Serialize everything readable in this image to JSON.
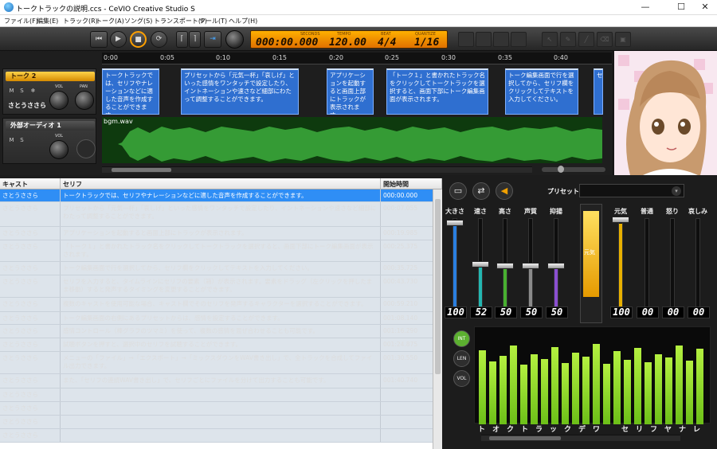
{
  "window": {
    "title": "トークトラックの説明.ccs - CeVIO Creative Studio S",
    "min": "—",
    "max": "☐",
    "close": "✕"
  },
  "menu": [
    "ファイル(F)",
    "編集(E)",
    "トラック(R)",
    "トーク(A)",
    "ソング(S)",
    "トランスポート(P)",
    "ツール(T)",
    "ヘルプ(H)"
  ],
  "transport": {
    "labels": [
      "SECONDS",
      "TEMPO",
      "BEAT",
      "QUANTIZE"
    ],
    "seconds": "000:00.000",
    "tempo": "120.00",
    "beat": "4/4",
    "quantize": "1/16"
  },
  "ruler": [
    "0:00",
    "0:05",
    "0:10",
    "0:15",
    "0:20",
    "0:25",
    "0:30",
    "0:35",
    "0:40"
  ],
  "tracks": [
    {
      "name": "トーク 2",
      "cast": "さとうささら",
      "vol": "VOL",
      "pan": "PAN",
      "m": "M",
      "s": "S"
    },
    {
      "name": "外部オーディオ 1",
      "m": "M",
      "s": "S",
      "vol": "VOL",
      "file": "bgm.wav"
    }
  ],
  "blocks": [
    "トークトラックでは、セリフやナレーションなどに適した音声を作成することができます。",
    "プリセットから「元気一杯」「哀しげ」といった感情をワンタッチで設定したり、イントネーションや速さなど細部にわたって調整することができます。",
    "アプリケーションを起動すると画面上部にトラックが表示されます。",
    "「トーク１」と書かれたトラック名をクリックしてトークトラックを選択すると、画面下部にトーク編集画面が表示されます。",
    "トーク編集画面で行を選択してから、セリフ欄をクリックしてテキストを入力してください。",
    "セ"
  ],
  "grid": {
    "headers": [
      "キャスト",
      "セリフ",
      "開始時間"
    ],
    "rows": [
      {
        "cast": "さとうささら",
        "text": "トークトラックでは、セリフやナレーションなどに適した音声を作成することができます。",
        "time": "000:00.000"
      },
      {
        "cast": "さとうささら",
        "text": "プリセットから「元気一杯」「哀しげ」といった感情をワンタッチで設定したり、イントネーションや速さなど細部にわたって調整することができます。",
        "time": "000:07.055"
      },
      {
        "cast": "さとうささら",
        "text": "アプリケーションを起動すると画面上部にトラックが表示されます。",
        "time": "000:19.985"
      },
      {
        "cast": "さとうささら",
        "text": "「トーク１」と書かれたトラック名をクリックしてトークトラックを選択すると、画面下部にトーク編集画面が表示されます。",
        "time": "000:25.375"
      },
      {
        "cast": "さとうささら",
        "text": "トーク編集画面で行を選択してから、セリフ欄をクリックしてテキストを入力してください。",
        "time": "000:35.725"
      },
      {
        "cast": "さとうささら",
        "text": "セリフを入力すると、タイムラインにセリフの要素（箱）が表示されます。要素をドラッグ（左クリックを押したまま移動）すると発声するタイミングを変更することができます。",
        "time": "000:43.730"
      },
      {
        "cast": "さとうささら",
        "text": "複数のキャストを使用可能な場合、キャスト欄でそのセリフを発声するキャラクターを選択することができます。",
        "time": "000:59.210"
      },
      {
        "cast": "さとうささら",
        "text": "トーク編集画面の右側にあるプリセットからは、感情を設定することができます。",
        "time": "001:08.140"
      },
      {
        "cast": "さとうささら",
        "text": "感情コントロール（棒グラフのツマミ）を使って、複数の感情を混ぜ合わせることも可能です。",
        "time": "001:16.290"
      },
      {
        "cast": "さとうささら",
        "text": "試聴ボタンを押すと、選択中のセリフを試聴することができます。",
        "time": "001:24.875"
      },
      {
        "cast": "さとうささら",
        "text": "メニューの「ファイル」→「エクスポート」→「ミックスダウンをWAV書き出し」で、全トラックを合成してファイル出力できます。",
        "time": "001:30.550"
      },
      {
        "cast": "さとうささら",
        "text": "また、「セリフの連続WAV書き出し」で、セリフごとにファイルを分けて出力することも可能です。",
        "time": "001:40.740"
      },
      {
        "cast": "さとうささら",
        "text": "",
        "time": ""
      },
      {
        "cast": "さとうささら",
        "text": "",
        "time": ""
      },
      {
        "cast": "さとうささら",
        "text": "",
        "time": ""
      },
      {
        "cast": "さとうささら",
        "text": "",
        "time": ""
      }
    ]
  },
  "preset": {
    "label": "プリセット",
    "value": ""
  },
  "sliders": [
    {
      "label": "大きさ",
      "value": "100",
      "level": 0.95,
      "color": "#2a7fe0"
    },
    {
      "label": "速さ",
      "value": "52",
      "level": 0.52,
      "color": "#23b6b0"
    },
    {
      "label": "高さ",
      "value": "50",
      "level": 0.5,
      "color": "#48b030"
    },
    {
      "label": "声質",
      "value": "50",
      "level": 0.5,
      "color": "#8a8a8a"
    },
    {
      "label": "抑揚",
      "value": "50",
      "level": 0.5,
      "color": "#8a4fd0"
    }
  ],
  "emotion_label": "元気",
  "emotions": [
    {
      "label": "元気",
      "value": "100",
      "level": 0.95,
      "color": "#e8b000"
    },
    {
      "label": "普通",
      "value": "00",
      "level": 0.0,
      "color": "#555"
    },
    {
      "label": "怒り",
      "value": "00",
      "level": 0.0,
      "color": "#555"
    },
    {
      "label": "哀しみ",
      "value": "00",
      "level": 0.0,
      "color": "#555"
    }
  ],
  "spec_buttons": [
    "INT",
    "LEN",
    "VOL"
  ],
  "spectrum": [
    0.85,
    0.72,
    0.78,
    0.9,
    0.68,
    0.8,
    0.75,
    0.88,
    0.7,
    0.82,
    0.77,
    0.92,
    0.69,
    0.84,
    0.74,
    0.87,
    0.71,
    0.8,
    0.76,
    0.9,
    0.73,
    0.86
  ],
  "katakana": [
    "ト",
    "オ",
    "ク",
    "ト",
    "ラ",
    "ッ",
    "ク",
    "デ",
    "ワ",
    "",
    "セ",
    "リ",
    "フ",
    "ヤ",
    "ナ",
    "レ"
  ]
}
